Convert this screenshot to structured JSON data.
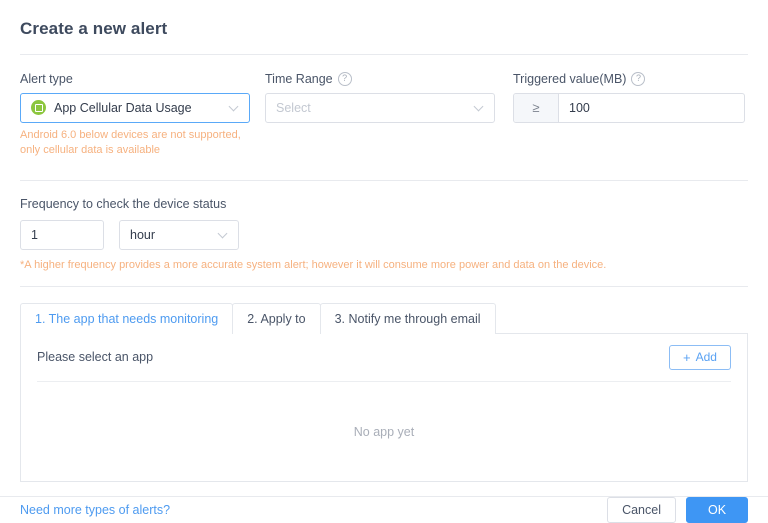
{
  "dialog": {
    "title": "Create a new alert"
  },
  "alert_type": {
    "label": "Alert type",
    "selected": "App Cellular Data Usage",
    "icon": "app-package-icon",
    "warning": "Android 6.0 below devices are not supported, only cellular data is available"
  },
  "time_range": {
    "label": "Time Range",
    "help_icon": "question-circle-icon",
    "placeholder": "Select",
    "value": ""
  },
  "triggered_value": {
    "label": "Triggered value(MB)",
    "help_icon": "question-circle-icon",
    "operator": "≥",
    "value": "100"
  },
  "frequency": {
    "label": "Frequency to check the device status",
    "count": "1",
    "unit": "hour",
    "hint": "*A higher frequency provides a more accurate system alert; however it will consume more power and data on the device."
  },
  "tabs": [
    {
      "label": "1. The app that needs monitoring",
      "active": true
    },
    {
      "label": "2. Apply to",
      "active": false
    },
    {
      "label": "3. Notify me through email",
      "active": false
    }
  ],
  "panel": {
    "select_app_label": "Please select an app",
    "add_button": "Add",
    "add_icon": "plus-icon",
    "empty_text": "No app yet"
  },
  "footer": {
    "link": "Need more types of alerts?",
    "cancel": "Cancel",
    "ok": "OK"
  },
  "colors": {
    "accent_blue": "#4e9bf0",
    "primary_button": "#3e96f4",
    "warning_orange": "#f6b17f",
    "app_icon_green": "#8cc63e"
  }
}
